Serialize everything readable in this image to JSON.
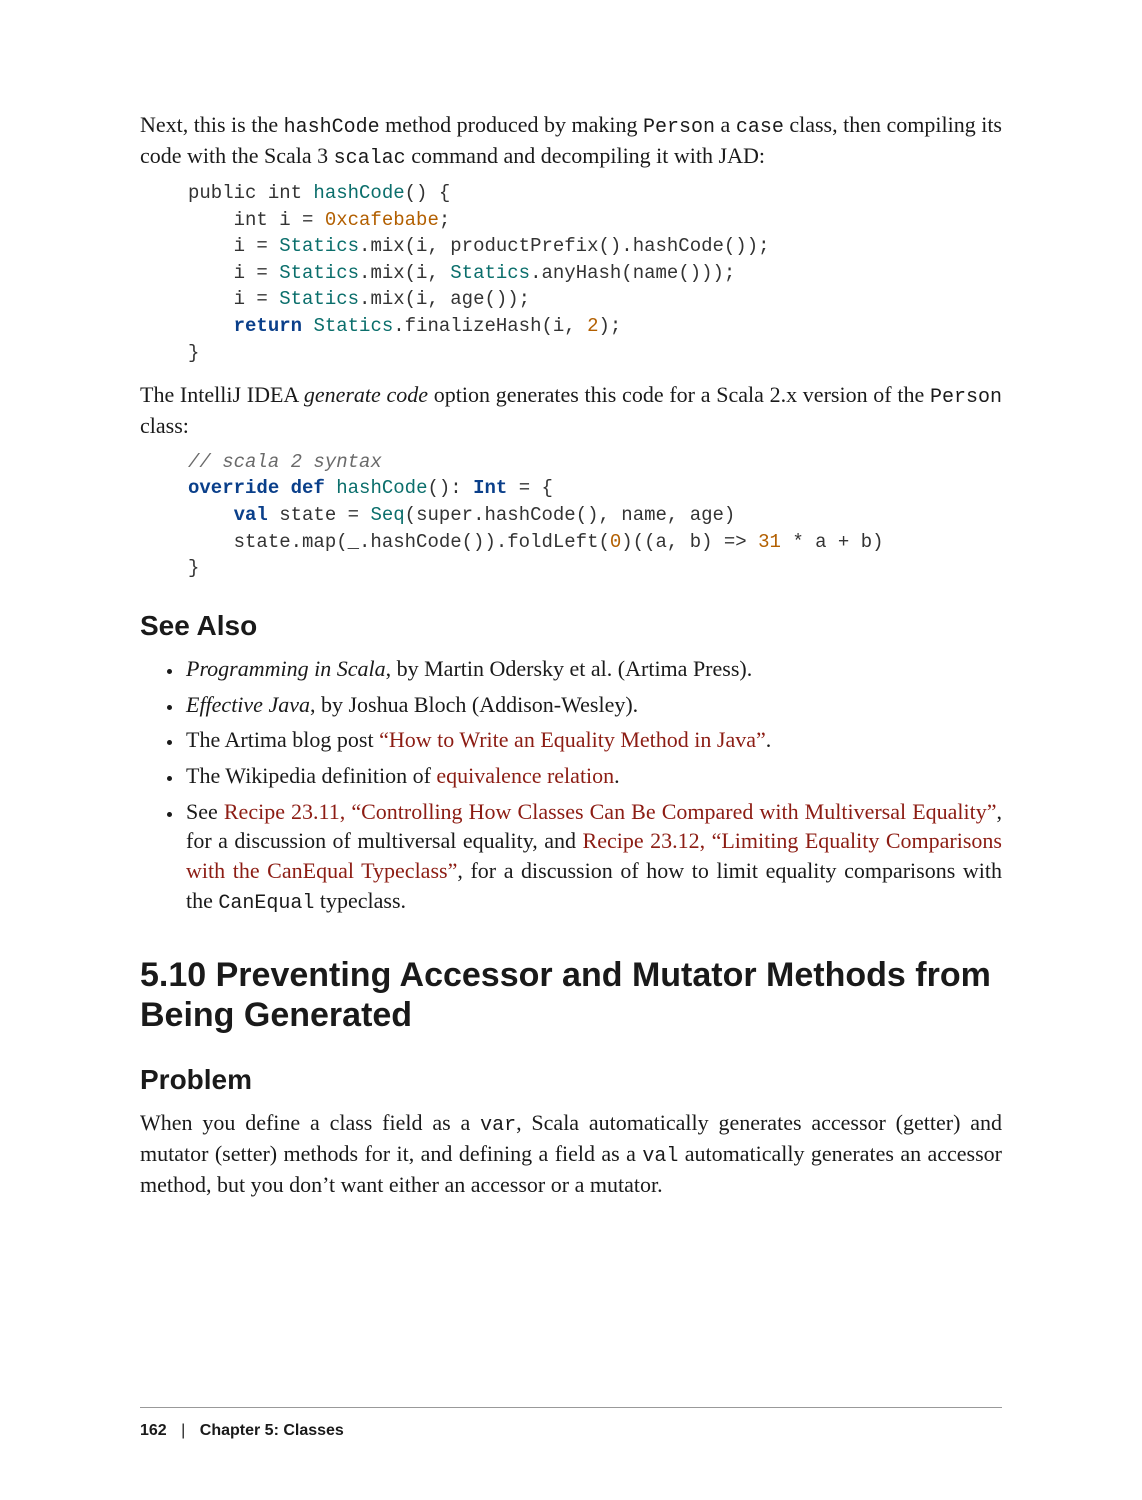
{
  "para1_pre": "Next, this is the ",
  "para1_code1": "hashCode",
  "para1_mid1": " method produced by making ",
  "para1_code2": "Person",
  "para1_mid2": " a ",
  "para1_code3": "case",
  "para1_mid3": " class, then compiling its code with the Scala 3 ",
  "para1_code4": "scalac",
  "para1_end": " command and decompiling it with JAD:",
  "code1": {
    "l1a": "public int ",
    "l1b": "hashCode",
    "l1c": "() {",
    "l2a": "    int i = ",
    "l2b": "0xcafebabe",
    "l2c": ";",
    "l3a": "    i = ",
    "l3b": "Statics",
    "l3c": ".mix(i, productPrefix().hashCode());",
    "l4a": "    i = ",
    "l4b": "Statics",
    "l4c": ".mix(i, ",
    "l4d": "Statics",
    "l4e": ".anyHash(name()));",
    "l5a": "    i = ",
    "l5b": "Statics",
    "l5c": ".mix(i, age());",
    "l6a": "    ",
    "l6b": "return",
    "l6c": " ",
    "l6d": "Statics",
    "l6e": ".finalizeHash(i, ",
    "l6f": "2",
    "l6g": ");",
    "l7": "}"
  },
  "para2_pre": "The IntelliJ IDEA ",
  "para2_em": "generate code",
  "para2_mid": " option generates this code for a Scala 2.x version of the ",
  "para2_code": "Person",
  "para2_end": " class:",
  "code2": {
    "l1": "// scala 2 syntax",
    "l2a": "override",
    "l2b": " ",
    "l2c": "def",
    "l2d": " ",
    "l2e": "hashCode",
    "l2f": "(): ",
    "l2g": "Int",
    "l2h": " = {",
    "l3a": "    ",
    "l3b": "val",
    "l3c": " state = ",
    "l3d": "Seq",
    "l3e": "(super.hashCode(), name, age)",
    "l4a": "    state.map(_.hashCode()).foldLeft(",
    "l4b": "0",
    "l4c": ")((a, b) => ",
    "l4d": "31",
    "l4e": " * a + b)",
    "l5": "}"
  },
  "see_also_heading": "See Also",
  "see_list": {
    "item1_em": "Programming in Scala",
    "item1_rest": ", by Martin Odersky et al. (Artima Press).",
    "item2_em": "Effective Java",
    "item2_rest": ", by Joshua Bloch (Addison-Wesley).",
    "item3_pre": "The Artima blog post ",
    "item3_link": "“How to Write an Equality Method in Java”",
    "item3_post": ".",
    "item4_pre": "The Wikipedia definition of ",
    "item4_link": "equivalence relation",
    "item4_post": ".",
    "item5_pre": "See ",
    "item5_link1": "Recipe 23.11, “Controlling How Classes Can Be Compared with Multiversal Equality”",
    "item5_mid": ", for a discussion of multiversal equality, and ",
    "item5_link2": "Recipe 23.12, “Limiting Equality Comparisons with the CanEqual Typeclass”",
    "item5_post1": ", for a discussion of how to limit equality comparisons with the ",
    "item5_code": "CanEqual",
    "item5_post2": " typeclass."
  },
  "section_title": "5.10 Preventing Accessor and Mutator Methods from Being Generated",
  "problem_heading": "Problem",
  "problem_p_a": "When you define a class field as a ",
  "problem_code1": "var",
  "problem_p_b": ", Scala automatically generates accessor (getter) and mutator (setter) methods for it, and defining a field as a ",
  "problem_code2": "val",
  "problem_p_c": " automatically generates an accessor method, but you don’t want either an accessor or a mutator.",
  "footer": {
    "page": "162",
    "sep": "|",
    "chapter": "Chapter 5: Classes"
  }
}
